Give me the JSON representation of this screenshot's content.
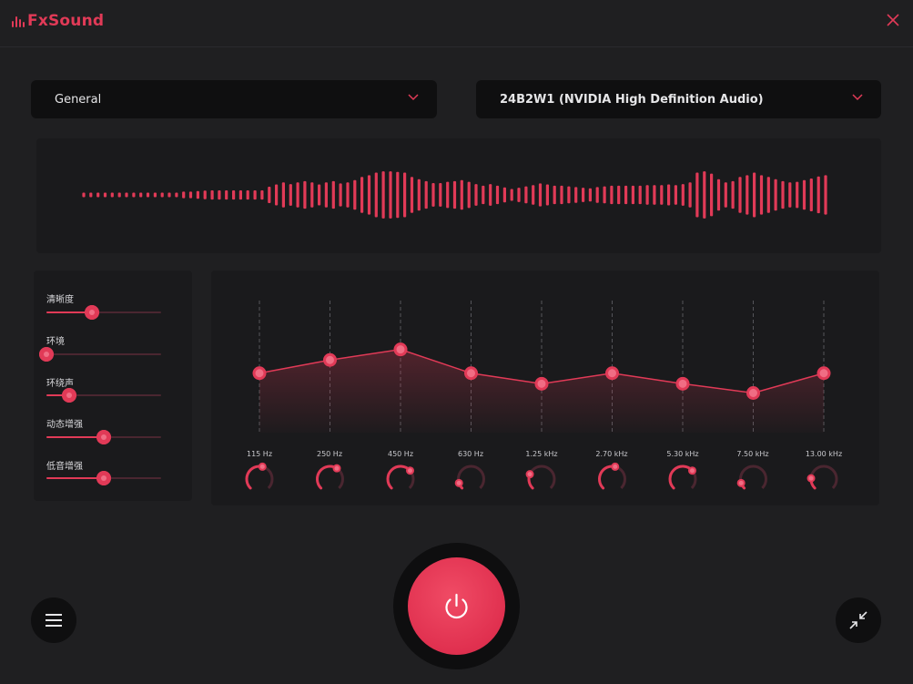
{
  "app": {
    "name": "FxSound",
    "accent_color": "#e13a57",
    "background_color": "#1f1f21"
  },
  "titlebar": {
    "close_icon": "close-icon"
  },
  "preset_select": {
    "value": "General"
  },
  "output_select": {
    "value": "24B2W1 (NVIDIA High Definition Audio)"
  },
  "effects": [
    {
      "label": "清晰度",
      "value": 0.4
    },
    {
      "label": "环境",
      "value": 0.0
    },
    {
      "label": "环绕声",
      "value": 0.2
    },
    {
      "label": "动态增强",
      "value": 0.5
    },
    {
      "label": "低音增强",
      "value": 0.5
    }
  ],
  "equalizer": {
    "bands": [
      {
        "freq": "115 Hz",
        "gain": 0.45
      },
      {
        "freq": "250 Hz",
        "gain": 0.55
      },
      {
        "freq": "450 Hz",
        "gain": 0.63
      },
      {
        "freq": "630 Hz",
        "gain": 0.45
      },
      {
        "freq": "1.25 kHz",
        "gain": 0.37
      },
      {
        "freq": "2.70 kHz",
        "gain": 0.45
      },
      {
        "freq": "5.30 kHz",
        "gain": 0.37
      },
      {
        "freq": "7.50 kHz",
        "gain": 0.3
      },
      {
        "freq": "13.00 kHz",
        "gain": 0.45
      }
    ],
    "knob_levels": [
      0.55,
      0.62,
      0.68,
      0.1,
      0.25,
      0.55,
      0.68,
      0.1,
      0.18
    ]
  },
  "waveform": {
    "levels": [
      0.07,
      0.07,
      0.07,
      0.07,
      0.07,
      0.07,
      0.07,
      0.07,
      0.07,
      0.07,
      0.07,
      0.07,
      0.07,
      0.07,
      0.1,
      0.1,
      0.12,
      0.13,
      0.14,
      0.14,
      0.14,
      0.14,
      0.14,
      0.14,
      0.14,
      0.14,
      0.25,
      0.32,
      0.38,
      0.33,
      0.38,
      0.42,
      0.38,
      0.32,
      0.38,
      0.42,
      0.35,
      0.38,
      0.45,
      0.55,
      0.6,
      0.68,
      0.72,
      0.72,
      0.7,
      0.68,
      0.55,
      0.48,
      0.42,
      0.36,
      0.36,
      0.4,
      0.42,
      0.45,
      0.4,
      0.33,
      0.28,
      0.33,
      0.28,
      0.23,
      0.18,
      0.22,
      0.26,
      0.3,
      0.35,
      0.32,
      0.28,
      0.28,
      0.26,
      0.24,
      0.22,
      0.2,
      0.24,
      0.26,
      0.28,
      0.28,
      0.28,
      0.28,
      0.28,
      0.3,
      0.3,
      0.3,
      0.32,
      0.3,
      0.33,
      0.38,
      0.68,
      0.72,
      0.65,
      0.48,
      0.38,
      0.42,
      0.55,
      0.6,
      0.68,
      0.6,
      0.55,
      0.48,
      0.42,
      0.38,
      0.4,
      0.45,
      0.5,
      0.56,
      0.6
    ]
  },
  "bottom": {
    "menu_icon": "hamburger-menu-icon",
    "power_icon": "power-icon",
    "minimize_icon": "collapse-arrows-icon"
  }
}
